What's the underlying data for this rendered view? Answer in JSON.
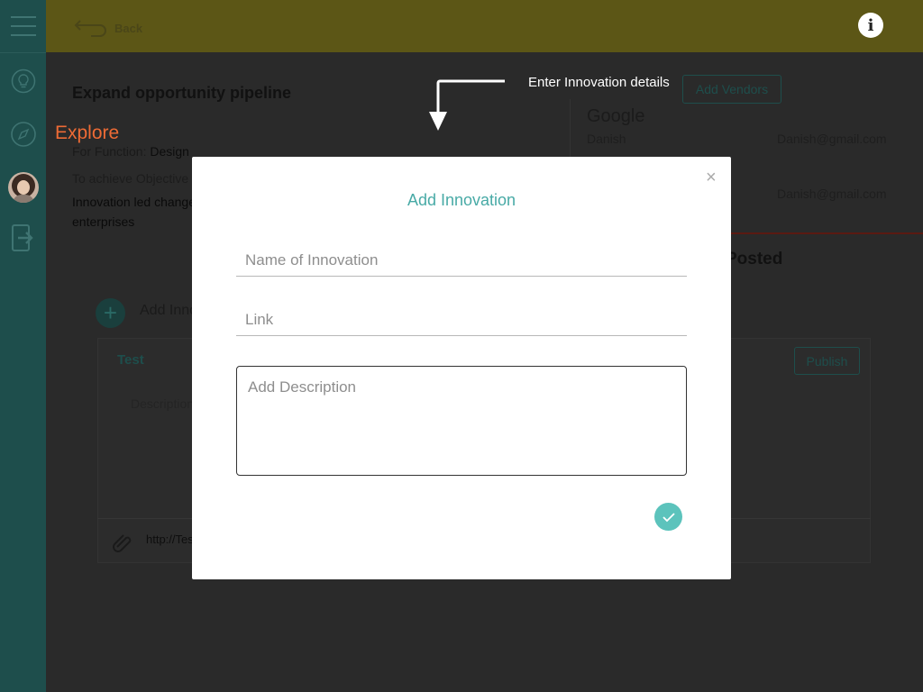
{
  "topbar": {
    "back_label": "Back",
    "info_glyph": "i"
  },
  "sidebar": {
    "icons": [
      "menu-icon",
      "lightbulb-icon",
      "compass-icon",
      "avatar",
      "logout-icon"
    ]
  },
  "background": {
    "title": "Expand opportunity pipeline",
    "function_label": "For Function:",
    "function_value": "Design",
    "objective_label": "To achieve Objective",
    "objective_value": "Innovation led change enterprises",
    "vendors_button": "Add Vendors",
    "vendor_name": "Google",
    "vendor_contact": "Danish",
    "vendor_email_1": "Danish@gmail.com",
    "vendor_email_2": "Danish@gmail.com",
    "posted_heading": "Posted",
    "add_innovation": "Add Innovation",
    "card_title": "Test",
    "card_description": "Description",
    "publish_button": "Publish",
    "card_link": "http://Test"
  },
  "tutorial": {
    "explore_label": "Explore",
    "hint_text": "Enter Innovation details",
    "explore_color": "#ee6b35"
  },
  "modal": {
    "title": "Add Innovation",
    "close_glyph": "×",
    "name_placeholder": "Name of Innovation",
    "name_value": "",
    "link_placeholder": "Link",
    "link_value": "",
    "description_placeholder": "Add Description",
    "description_value": "",
    "accent_color": "#48aaa6"
  }
}
